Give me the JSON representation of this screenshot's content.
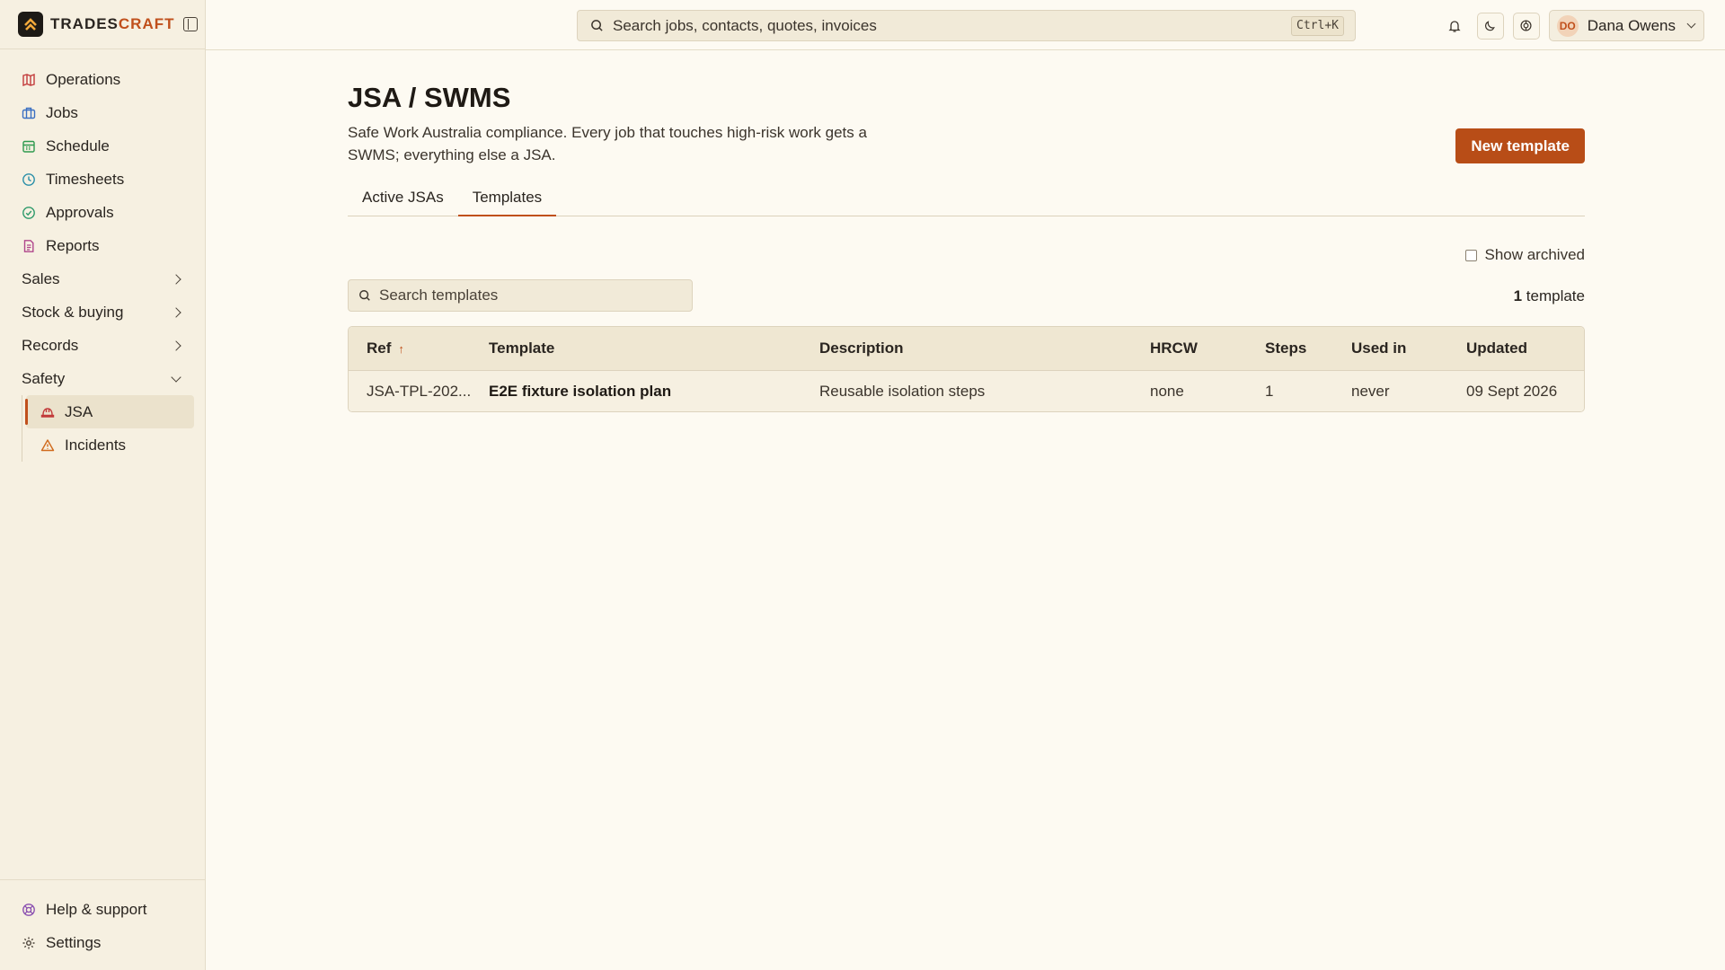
{
  "brand": {
    "name_main": "TRADES",
    "name_accent": "CRAFT"
  },
  "sidebar": {
    "items": [
      {
        "label": "Operations"
      },
      {
        "label": "Jobs"
      },
      {
        "label": "Schedule"
      },
      {
        "label": "Timesheets"
      },
      {
        "label": "Approvals"
      },
      {
        "label": "Reports"
      }
    ],
    "groups": [
      {
        "label": "Sales"
      },
      {
        "label": "Stock & buying"
      },
      {
        "label": "Records"
      },
      {
        "label": "Safety"
      }
    ],
    "safety_items": [
      {
        "label": "JSA"
      },
      {
        "label": "Incidents"
      }
    ],
    "footer": [
      {
        "label": "Help & support"
      },
      {
        "label": "Settings"
      }
    ]
  },
  "topbar": {
    "search_placeholder": "Search jobs, contacts, quotes, invoices",
    "shortcut": "Ctrl+K",
    "user_initials": "DO",
    "user_name": "Dana Owens"
  },
  "page": {
    "title": "JSA / SWMS",
    "subtitle": "Safe Work Australia compliance. Every job that touches high-risk work gets a SWMS; everything else a JSA.",
    "new_button": "New template",
    "tabs": [
      {
        "label": "Active JSAs",
        "active": false
      },
      {
        "label": "Templates",
        "active": true
      }
    ],
    "show_archived": "Show archived",
    "search_placeholder": "Search templates",
    "count_number": "1",
    "count_label": " template"
  },
  "table": {
    "headers": [
      "Ref",
      "Template",
      "Description",
      "HRCW",
      "Steps",
      "Used in",
      "Updated"
    ],
    "rows": [
      {
        "ref": "JSA-TPL-202...",
        "template": "E2E fixture isolation plan",
        "description": "Reusable isolation steps",
        "hrcw": "none",
        "steps": "1",
        "used_in": "never",
        "updated": "09 Sept 2026"
      }
    ]
  },
  "colors": {
    "accent": "#c0501c",
    "button": "#b84d17",
    "background": "#fdfaf2",
    "sidebar": "#f6f0e1"
  }
}
